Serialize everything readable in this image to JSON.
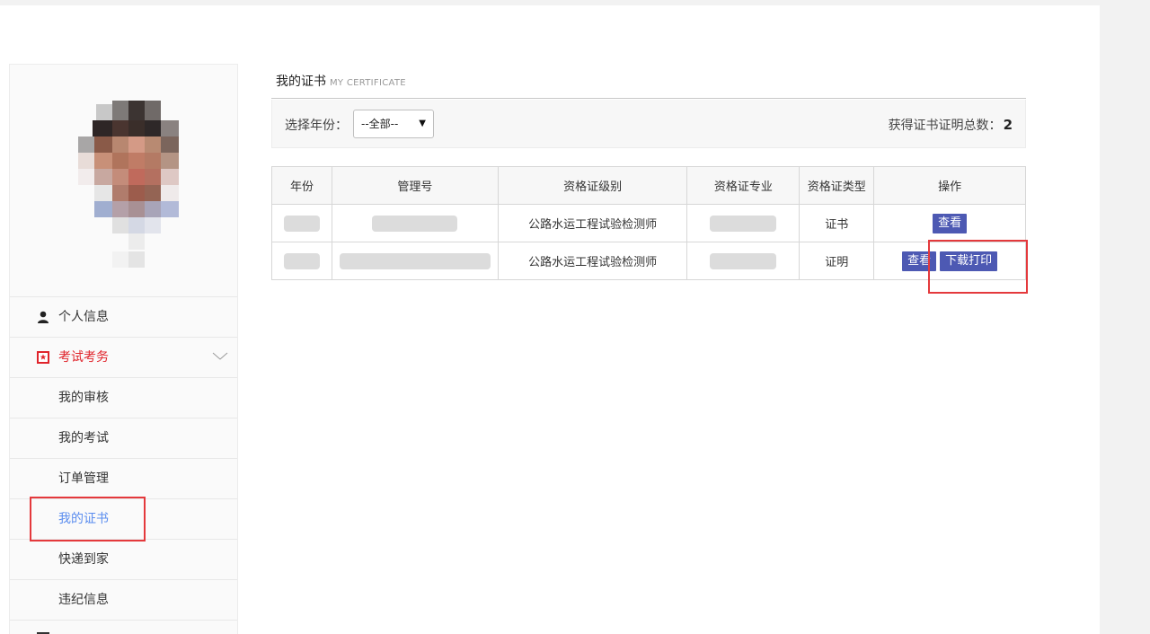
{
  "sidebar": {
    "menu": [
      {
        "label": "个人信息",
        "icon": "user-icon"
      },
      {
        "label": "考试考务",
        "icon": "exam-icon",
        "expanded": true
      }
    ],
    "submenu": [
      {
        "label": "我的审核"
      },
      {
        "label": "我的考试"
      },
      {
        "label": "订单管理"
      },
      {
        "label": "我的证书",
        "selected": true
      },
      {
        "label": "快递到家"
      },
      {
        "label": "违纪信息"
      }
    ]
  },
  "main": {
    "title": "我的证书",
    "title_en": "MY CERTIFICATE",
    "filter_label": "选择年份：",
    "year_select_value": "--全部--",
    "count_label": "获得证书证明总数：",
    "count_value": "2"
  },
  "table": {
    "headers": [
      "年份",
      "管理号",
      "资格证级别",
      "资格证专业",
      "资格证类型",
      "操作"
    ],
    "rows": [
      {
        "level": "公路水运工程试验检测师",
        "type": "证书",
        "actions": [
          "查看"
        ]
      },
      {
        "level": "公路水运工程试验检测师",
        "type": "证明",
        "actions": [
          "查看",
          "下载打印"
        ]
      }
    ]
  },
  "colors": {
    "accent_button": "#4d59b3",
    "active_menu": "#e0242b",
    "selected_sub": "#5b8def",
    "highlight_box": "#e4393c"
  }
}
